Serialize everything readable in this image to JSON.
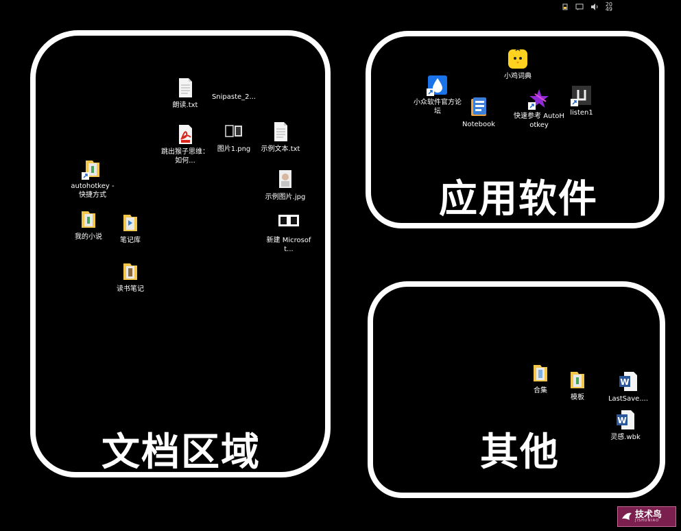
{
  "taskbar": {
    "clock_top": "20",
    "clock_bottom": "49"
  },
  "zones": {
    "docs": {
      "title": "文档区域"
    },
    "apps": {
      "title": "应用软件"
    },
    "other": {
      "title": "其他"
    }
  },
  "icons": {
    "langdu_txt": "朗读.txt",
    "snipaste": "Snipaste_2...",
    "tiaochu_pdf": "跳出猴子思维：如何...",
    "tupian1_png": "图片1.png",
    "shili_wenben": "示例文本.txt",
    "autohotkey_shortcut": "autohotkey - 快捷方式",
    "shili_tupian": "示例图片.jpg",
    "xinjian_microsoft": "新建 Microsoft...",
    "wode_xiaoshuo": "我的小说",
    "biji_ku": "笔记库",
    "dushu_biji": "读书笔记",
    "xiaoji_cidian": "小鸡词典",
    "xiaozhong_luntan": "小众软件官方论坛",
    "notebook": "Notebook",
    "kuaisu_cankao": "快速参考 AutoHotkey",
    "listen1": "listen1",
    "heji": "合集",
    "moban": "模板",
    "lastsave": "LastSave....",
    "linggan_wbk": "灵感.wbk"
  },
  "watermark": {
    "cn": "技术鸟",
    "en": "JISHUNIAO"
  },
  "colors": {
    "background": "#000000",
    "zone_border": "#ffffff",
    "folder_yellow": "#f3c74b",
    "pdf_red": "#d9261c",
    "word_blue": "#2b579a",
    "watermark_bg": "#7b1f4e"
  }
}
